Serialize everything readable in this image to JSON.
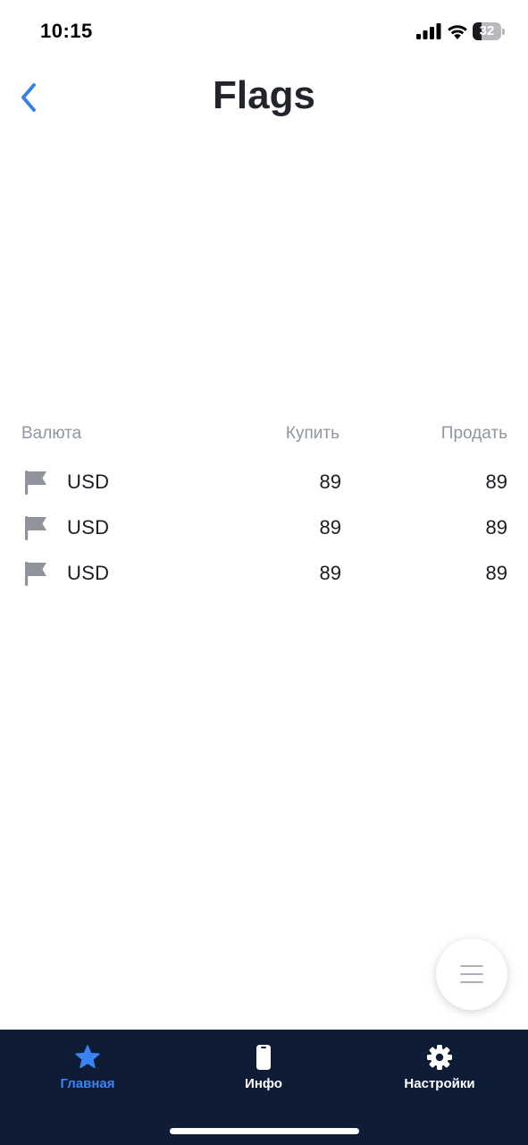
{
  "status_bar": {
    "time": "10:15",
    "battery_level": "32",
    "battery_fraction": 0.32
  },
  "header": {
    "title": "Flags",
    "back_icon": "chevron-left-icon"
  },
  "table": {
    "columns": [
      "Валюта",
      "Купить",
      "Продать"
    ],
    "rows": [
      {
        "icon": "flag-icon",
        "currency": "USD",
        "buy": "89",
        "sell": "89"
      },
      {
        "icon": "flag-icon",
        "currency": "USD",
        "buy": "89",
        "sell": "89"
      },
      {
        "icon": "flag-icon",
        "currency": "USD",
        "buy": "89",
        "sell": "89"
      }
    ]
  },
  "fab": {
    "icon": "menu-icon"
  },
  "tab_bar": {
    "tabs": [
      {
        "label": "Главная",
        "icon": "star-icon",
        "active": true
      },
      {
        "label": "Инфо",
        "icon": "phone-icon",
        "active": false
      },
      {
        "label": "Настройки",
        "icon": "gear-icon",
        "active": false
      }
    ]
  },
  "colors": {
    "accent": "#3b82f6",
    "tab_bar_bg": "#0f1c36",
    "tab_inactive": "#ffffff",
    "header_text": "#8e95a3",
    "flag_icon": "#8f939c"
  }
}
